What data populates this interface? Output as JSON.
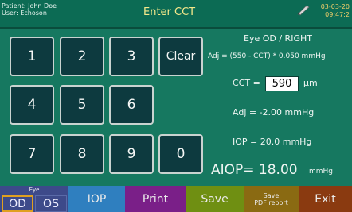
{
  "header": {
    "patient": "Patient: John Doe",
    "user": "User: Echoson",
    "title": "Enter CCT",
    "date": "03-03-20",
    "time": "09:47:2"
  },
  "keypad": {
    "keys": [
      "1",
      "2",
      "3",
      "Clear",
      "4",
      "5",
      "6",
      "7",
      "8",
      "9",
      "0"
    ]
  },
  "panel": {
    "eye": "Eye OD / RIGHT",
    "formula": "Adj = (550 - CCT) * 0.050 mmHg",
    "cct_label": "CCT =",
    "cct_value": "590",
    "cct_unit": "µm",
    "adj": "Adj =  -2.00 mmHg",
    "iop": "IOP =  20.0  mmHg",
    "aiop_label": "AIOP= 18.00",
    "aiop_unit": "mmHg"
  },
  "bottom": {
    "eye_label": "Eye",
    "od": "OD",
    "os": "OS",
    "iop": "IOP",
    "print": "Print",
    "save": "Save",
    "save_pdf_1": "Save",
    "save_pdf_2": "PDF report",
    "exit": "Exit"
  },
  "colors": {
    "background": "#167860",
    "key": "#0d3a3f",
    "iop_button": "#2f7fbf",
    "print_button": "#7a1f88",
    "save_button": "#6f8f12",
    "save_pdf_button": "#8a6a12",
    "exit_button": "#8a3a10",
    "eye_selected_border": "#e0a020"
  }
}
